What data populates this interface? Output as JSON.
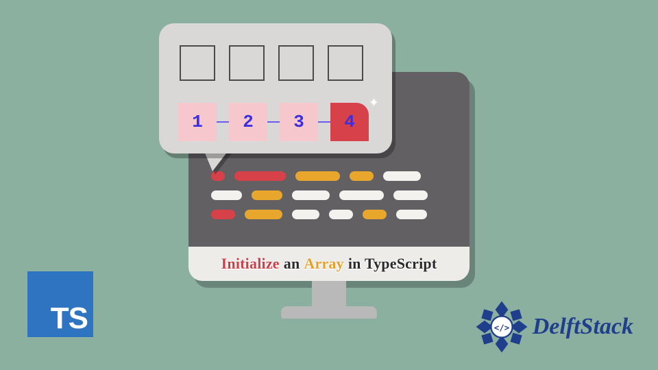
{
  "caption": {
    "initialize": "Initialize",
    "an": "an",
    "array": "Array",
    "rest": "in TypeScript"
  },
  "array_card": {
    "slot_count": 4,
    "values": [
      "1",
      "2",
      "3",
      "4"
    ],
    "highlight_last": true
  },
  "ts_badge": {
    "label": "TS"
  },
  "delftstack": {
    "name": "DelftStack",
    "code_glyph": "</>"
  },
  "colors": {
    "background": "#8cb0a0",
    "monitor": "#636064",
    "card": "#d9d8d7",
    "cell": "#f6c7cc",
    "highlight": "#d6414a",
    "orange": "#e9a62d",
    "ts_blue": "#2f74c0",
    "delft_blue": "#1f3f8c"
  }
}
